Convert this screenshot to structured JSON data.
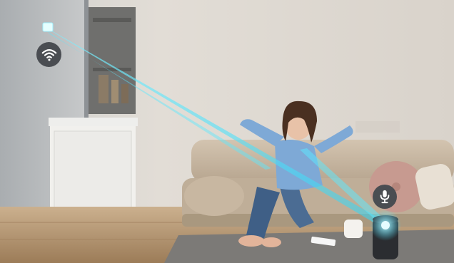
{
  "image": {
    "description_free": true
  },
  "icons": {
    "wifi": "wifi-icon",
    "microphone": "microphone-icon",
    "beam": "connection-beam"
  },
  "colors": {
    "wall": "#ddd8d1",
    "wall_light": "#e7e2dc",
    "floor_wood": "#b89b78",
    "sofa": "#c9b9a5",
    "beam": "#4fe3ff",
    "speaker": "#2b2d31",
    "icon_bg": "#4a4d52"
  }
}
